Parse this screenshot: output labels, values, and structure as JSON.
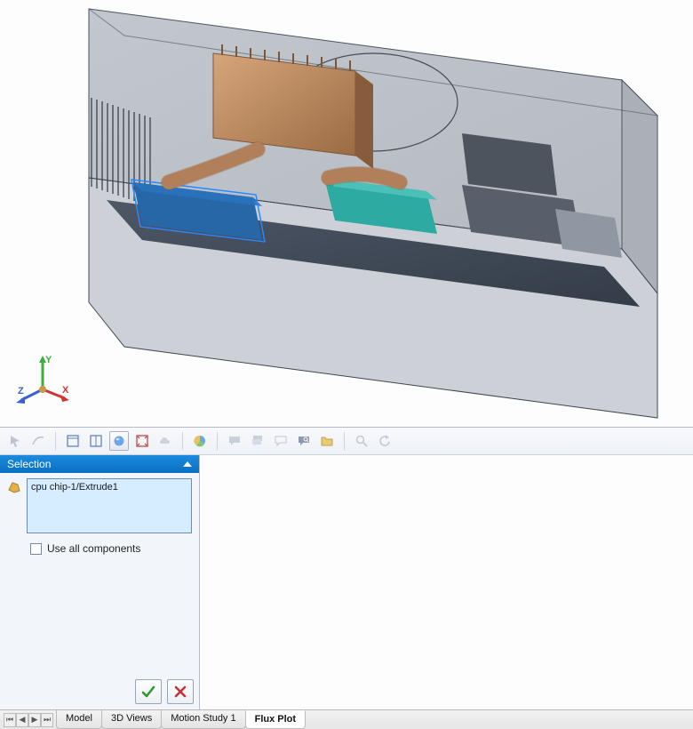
{
  "viewport": {
    "triad_labels": {
      "x": "X",
      "y": "Y",
      "z": "Z"
    }
  },
  "toolbar": {
    "icons": [
      "cursor-icon",
      "edge-select-icon",
      "separator",
      "window-icon",
      "pane-icon",
      "sphere-icon",
      "fit-bounds-icon",
      "cloud-icon",
      "separator",
      "pie-chart-icon",
      "separator",
      "comment-icon",
      "comment-stack-icon",
      "comment-outline-icon",
      "search-bubble-icon",
      "folder-icon",
      "separator",
      "zoom-icon",
      "undo-icon"
    ]
  },
  "panel": {
    "section_title": "Selection",
    "selected_item": "cpu chip-1/Extrude1",
    "use_all_components_label": "Use all components",
    "use_all_components_checked": false
  },
  "tabs": {
    "scroll_buttons": [
      "⏮",
      "◀",
      "▶",
      "⏭"
    ],
    "items": [
      {
        "label": "Model",
        "active": false
      },
      {
        "label": "3D Views",
        "active": false
      },
      {
        "label": "Motion Study 1",
        "active": false
      },
      {
        "label": "Flux Plot",
        "active": true
      }
    ]
  },
  "colors": {
    "selection_highlight": "#4aa0ff",
    "accent_header": "#0a6fc0"
  }
}
